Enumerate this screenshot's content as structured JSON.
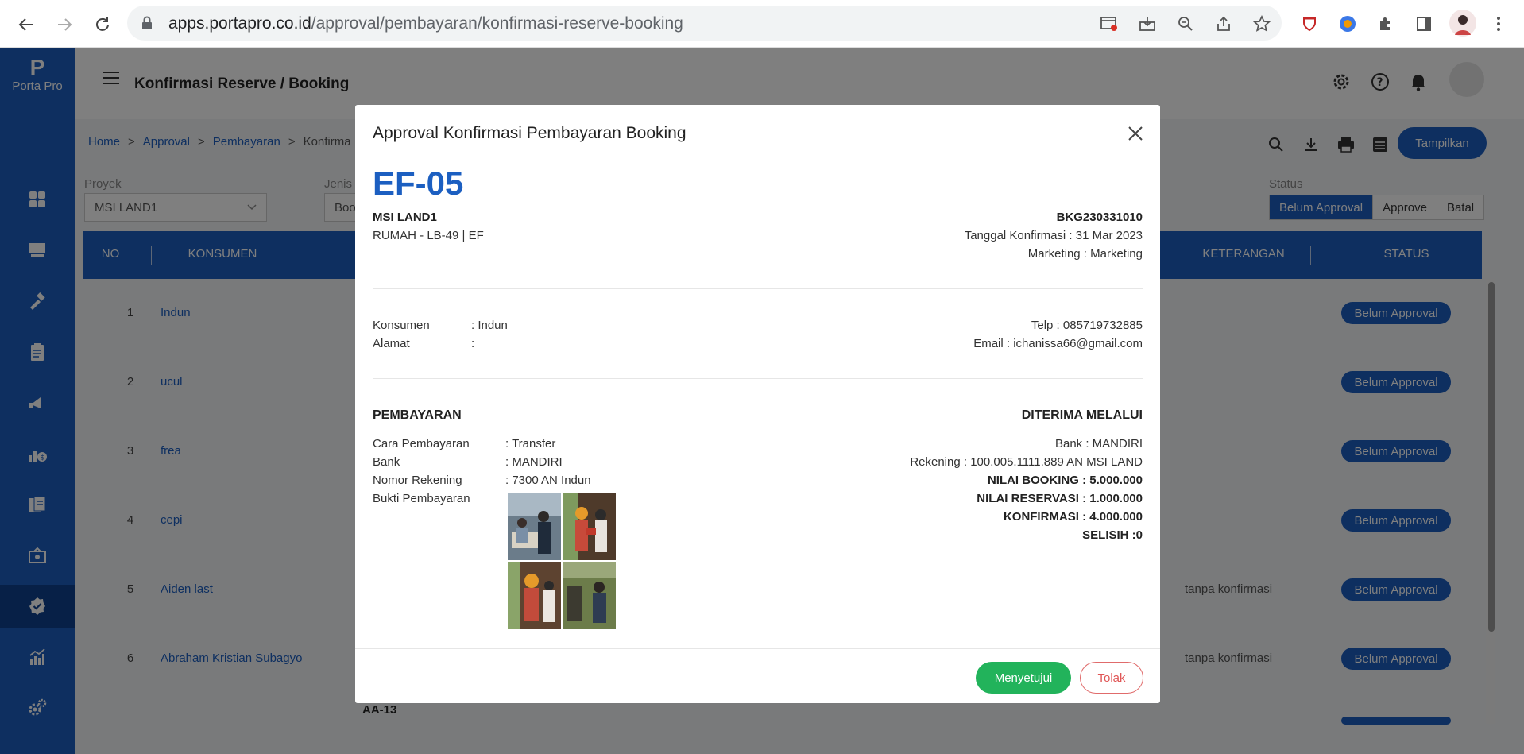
{
  "browser": {
    "url_domain": "apps.portapro.co.id",
    "url_path": "/approval/pembayaran/konfirmasi-reserve-booking"
  },
  "app": {
    "logo_mark": "P",
    "logo_name": "Porta Pro",
    "page_title": "Konfirmasi Reserve / Booking",
    "brand_color": "#1c5fc1"
  },
  "breadcrumb": {
    "home": "Home",
    "approval": "Approval",
    "pembayaran": "Pembayaran",
    "current": "Konfirma",
    "separator": ">"
  },
  "toolbar": {
    "tampilkan_label": "Tampilkan"
  },
  "filters": {
    "proyek_label": "Proyek",
    "proyek_value": "MSI LAND1",
    "jenis_label": "Jenis",
    "jenis_value": "Boo",
    "status_label": "Status",
    "status_options": [
      "Belum Approval",
      "Approve",
      "Batal"
    ]
  },
  "table": {
    "headers": {
      "no": "NO",
      "konsumen": "KONSUMEN",
      "keterangan": "KETERANGAN",
      "status": "STATUS"
    },
    "rows": [
      {
        "no": "1",
        "name": "Indun",
        "keterangan": "",
        "status": "Belum Approval"
      },
      {
        "no": "2",
        "name": "ucul",
        "keterangan": "",
        "status": "Belum Approval"
      },
      {
        "no": "3",
        "name": "frea",
        "keterangan": "",
        "status": "Belum Approval"
      },
      {
        "no": "4",
        "name": "cepi",
        "keterangan": "",
        "status": "Belum Approval"
      },
      {
        "no": "5",
        "name": "Aiden last",
        "keterangan": "tanpa konfirmasi",
        "status": "Belum Approval"
      },
      {
        "no": "6",
        "name": "Abraham Kristian Subagyo",
        "keterangan": "tanpa konfirmasi",
        "status": "Belum Approval"
      }
    ],
    "partial_row_text": "AA-13"
  },
  "modal": {
    "title": "Approval Konfirmasi Pembayaran Booking",
    "unit": "EF-05",
    "project": "MSI LAND1",
    "unit_detail": "RUMAH - LB-49 | EF",
    "booking_code": "BKG230331010",
    "tanggal": "Tanggal Konfirmasi : 31 Mar 2023",
    "marketing": "Marketing : Marketing",
    "konsumen_label": "Konsumen",
    "konsumen_value": ": Indun",
    "alamat_label": "Alamat",
    "alamat_value": ":",
    "telp": "Telp : 085719732885",
    "email": "Email : ichanissa66@gmail.com",
    "pembayaran_heading": "PEMBAYARAN",
    "diterima_heading": "DITERIMA MELALUI",
    "cara_label": "Cara Pembayaran",
    "cara_value": ": Transfer",
    "bank_label": "Bank",
    "bank_value": ": MANDIRI",
    "norek_label": "Nomor Rekening",
    "norek_value": ": 7300 AN Indun",
    "bukti_label": "Bukti Pembayaran",
    "recv_bank": "Bank : MANDIRI",
    "recv_rekening": "Rekening : 100.005.1111.889 AN MSI LAND",
    "nilai_booking": "NILAI BOOKING : 5.000.000",
    "nilai_reservasi": "NILAI RESERVASI : 1.000.000",
    "konfirmasi": "KONFIRMASI : 4.000.000",
    "selisih": "SELISIH :0",
    "approve_label": "Menyetujui",
    "reject_label": "Tolak"
  }
}
